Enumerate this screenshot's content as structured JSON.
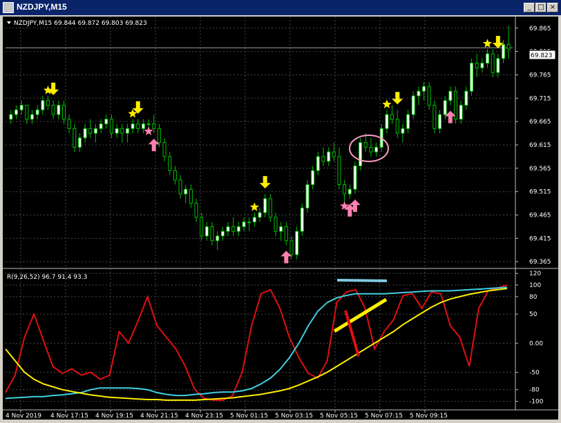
{
  "window": {
    "title": "NZDJPY,M15",
    "buttons": [
      "_",
      "□",
      "×"
    ]
  },
  "header": {
    "symbol_line": "NZDJPY,M15  69.844 69.872 69.803 69.823"
  },
  "price_axis": {
    "labels": [
      "69.865",
      "69.823",
      "69.815",
      "69.765",
      "69.715",
      "69.665",
      "69.615",
      "69.565",
      "69.515",
      "69.465",
      "69.415",
      "69.365"
    ],
    "current_price": "69.823"
  },
  "indicator": {
    "label": "R(9,26,52) 96.7 91.4 93.3",
    "axis_labels": [
      "120",
      "100",
      "80",
      "50",
      "0.00",
      "-50",
      "-80",
      "-100"
    ]
  },
  "time_axis": {
    "labels": [
      "4 Nov 2019",
      "4 Nov 17:15",
      "4 Nov 19:15",
      "4 Nov 21:15",
      "4 Nov 23:15",
      "5 Nov 01:15",
      "5 Nov 03:15",
      "5 Nov 05:15",
      "5 Nov 07:15",
      "5 Nov 09:15"
    ]
  },
  "colors": {
    "background": "#000000",
    "bull_candle": "#ffffff",
    "bear_candle": "#000000",
    "wick": "#00c000",
    "grid": "#4a4a4a",
    "arrow_down": "#ffee00",
    "arrow_up": "#ff7fb0",
    "star_gold": "#ffee00",
    "star_pink": "#ff7fb0",
    "line_red": "#e01010",
    "line_cyan": "#40d0e0",
    "line_yellow": "#ffee00",
    "title_bar": "#0a246a"
  },
  "chart_data": [
    {
      "type": "candlestick",
      "title": "NZDJPY,M15",
      "ohlc": [
        [
          69.67,
          69.69,
          69.66,
          69.68
        ],
        [
          69.68,
          69.7,
          69.67,
          69.69
        ],
        [
          69.69,
          69.71,
          69.68,
          69.7
        ],
        [
          69.7,
          69.7,
          69.66,
          69.67
        ],
        [
          69.67,
          69.69,
          69.66,
          69.68
        ],
        [
          69.68,
          69.7,
          69.67,
          69.69
        ],
        [
          69.69,
          69.72,
          69.68,
          69.71
        ],
        [
          69.71,
          69.72,
          69.69,
          69.7
        ],
        [
          69.7,
          69.71,
          69.67,
          69.68
        ],
        [
          69.68,
          69.71,
          69.67,
          69.7
        ],
        [
          69.7,
          69.71,
          69.66,
          69.67
        ],
        [
          69.67,
          69.68,
          69.64,
          69.65
        ],
        [
          69.65,
          69.66,
          69.6,
          69.61
        ],
        [
          69.61,
          69.64,
          69.6,
          69.63
        ],
        [
          69.63,
          69.66,
          69.62,
          69.65
        ],
        [
          69.65,
          69.67,
          69.63,
          69.64
        ],
        [
          69.64,
          69.66,
          69.62,
          69.65
        ],
        [
          69.65,
          69.67,
          69.64,
          69.66
        ],
        [
          69.66,
          69.68,
          69.65,
          69.67
        ],
        [
          69.67,
          69.68,
          69.63,
          69.64
        ],
        [
          69.64,
          69.66,
          69.63,
          69.65
        ],
        [
          69.65,
          69.66,
          69.62,
          69.64
        ],
        [
          69.64,
          69.66,
          69.62,
          69.65
        ],
        [
          69.65,
          69.67,
          69.64,
          69.66
        ],
        [
          69.66,
          69.67,
          69.64,
          69.65
        ],
        [
          69.65,
          69.67,
          69.64,
          69.66
        ],
        [
          69.66,
          69.67,
          69.65,
          69.66
        ],
        [
          69.66,
          69.68,
          69.64,
          69.65
        ],
        [
          69.65,
          69.66,
          69.61,
          69.62
        ],
        [
          69.62,
          69.63,
          69.58,
          69.59
        ],
        [
          69.59,
          69.6,
          69.55,
          69.56
        ],
        [
          69.56,
          69.57,
          69.53,
          69.54
        ],
        [
          69.54,
          69.55,
          69.5,
          69.51
        ],
        [
          69.51,
          69.53,
          69.49,
          69.52
        ],
        [
          69.52,
          69.53,
          69.48,
          69.49
        ],
        [
          69.49,
          69.5,
          69.45,
          69.46
        ],
        [
          69.46,
          69.47,
          69.41,
          69.42
        ],
        [
          69.42,
          69.45,
          69.41,
          69.44
        ],
        [
          69.44,
          69.45,
          69.4,
          69.41
        ],
        [
          69.41,
          69.43,
          69.39,
          69.42
        ],
        [
          69.42,
          69.44,
          69.41,
          69.43
        ],
        [
          69.43,
          69.45,
          69.42,
          69.44
        ],
        [
          69.44,
          69.46,
          69.42,
          69.43
        ],
        [
          69.43,
          69.45,
          69.42,
          69.44
        ],
        [
          69.44,
          69.46,
          69.43,
          69.45
        ],
        [
          69.45,
          69.46,
          69.43,
          69.45
        ],
        [
          69.45,
          69.47,
          69.44,
          69.46
        ],
        [
          69.46,
          69.48,
          69.45,
          69.47
        ],
        [
          69.47,
          69.51,
          69.46,
          69.5
        ],
        [
          69.5,
          69.51,
          69.45,
          69.46
        ],
        [
          69.46,
          69.47,
          69.42,
          69.43
        ],
        [
          69.43,
          69.45,
          69.41,
          69.44
        ],
        [
          69.44,
          69.45,
          69.4,
          69.41
        ],
        [
          69.41,
          69.42,
          69.37,
          69.38
        ],
        [
          69.38,
          69.44,
          69.37,
          69.43
        ],
        [
          69.43,
          69.49,
          69.42,
          69.48
        ],
        [
          69.48,
          69.54,
          69.47,
          69.53
        ],
        [
          69.53,
          69.57,
          69.52,
          69.56
        ],
        [
          69.56,
          69.6,
          69.55,
          69.59
        ],
        [
          69.59,
          69.61,
          69.57,
          69.58
        ],
        [
          69.58,
          69.61,
          69.57,
          69.6
        ],
        [
          69.6,
          69.62,
          69.58,
          69.59
        ],
        [
          69.59,
          69.61,
          69.52,
          69.53
        ],
        [
          69.53,
          69.54,
          69.49,
          69.51
        ],
        [
          69.51,
          69.53,
          69.5,
          69.52
        ],
        [
          69.52,
          69.58,
          69.51,
          69.57
        ],
        [
          69.57,
          69.63,
          69.56,
          69.62
        ],
        [
          69.62,
          69.64,
          69.6,
          69.61
        ],
        [
          69.61,
          69.63,
          69.59,
          69.6
        ],
        [
          69.6,
          69.62,
          69.59,
          69.61
        ],
        [
          69.61,
          69.66,
          69.6,
          69.65
        ],
        [
          69.65,
          69.69,
          69.64,
          69.68
        ],
        [
          69.68,
          69.7,
          69.66,
          69.67
        ],
        [
          69.67,
          69.69,
          69.63,
          69.64
        ],
        [
          69.64,
          69.66,
          69.62,
          69.65
        ],
        [
          69.65,
          69.69,
          69.64,
          69.68
        ],
        [
          69.68,
          69.73,
          69.67,
          69.72
        ],
        [
          69.72,
          69.74,
          69.7,
          69.73
        ],
        [
          69.73,
          69.75,
          69.71,
          69.74
        ],
        [
          69.74,
          69.75,
          69.69,
          69.7
        ],
        [
          69.7,
          69.71,
          69.64,
          69.65
        ],
        [
          69.65,
          69.69,
          69.64,
          69.68
        ],
        [
          69.68,
          69.72,
          69.67,
          69.71
        ],
        [
          69.71,
          69.74,
          69.7,
          69.73
        ],
        [
          69.73,
          69.74,
          69.66,
          69.67
        ],
        [
          69.67,
          69.71,
          69.66,
          69.7
        ],
        [
          69.7,
          69.74,
          69.69,
          69.73
        ],
        [
          69.73,
          69.8,
          69.72,
          69.79
        ],
        [
          69.79,
          69.81,
          69.76,
          69.78
        ],
        [
          69.78,
          69.8,
          69.77,
          69.79
        ],
        [
          69.79,
          69.82,
          69.78,
          69.81
        ],
        [
          69.81,
          69.82,
          69.76,
          69.77
        ],
        [
          69.77,
          69.81,
          69.76,
          69.8
        ],
        [
          69.8,
          69.84,
          69.79,
          69.83
        ],
        [
          69.83,
          69.87,
          69.8,
          69.82
        ]
      ],
      "ylim": [
        69.355,
        69.875
      ],
      "signals": {
        "arrows_down": [
          8,
          24,
          48,
          73,
          92
        ],
        "arrows_up": [
          27,
          52,
          64,
          65,
          83
        ],
        "stars_gold": [
          7,
          23,
          46,
          71,
          90
        ],
        "stars_pink": [
          26,
          63
        ]
      }
    },
    {
      "type": "line",
      "title": "R(9,26,52) 96.7 91.4 93.3",
      "ylim": [
        -110,
        125
      ],
      "series": [
        {
          "color": "#e01010",
          "values": [
            -85,
            -55,
            10,
            50,
            5,
            -40,
            -52,
            -44,
            -55,
            -50,
            -62,
            -55,
            20,
            0,
            38,
            80,
            30,
            10,
            -10,
            -40,
            -80,
            -95,
            -98,
            -98,
            -90,
            -50,
            30,
            85,
            92,
            60,
            10,
            -25,
            -52,
            -60,
            -30,
            70,
            88,
            92,
            60,
            -10,
            20,
            40,
            82,
            85,
            60,
            88,
            85,
            30,
            10,
            -40,
            60,
            90,
            95,
            100
          ]
        },
        {
          "color": "#40d0e0",
          "values": [
            -95,
            -94,
            -93,
            -92,
            -92,
            -90,
            -89,
            -87,
            -85,
            -80,
            -77,
            -77,
            -77,
            -77,
            -78,
            -80,
            -85,
            -88,
            -90,
            -90,
            -88,
            -87,
            -85,
            -84,
            -84,
            -82,
            -78,
            -70,
            -60,
            -45,
            -25,
            0,
            30,
            55,
            70,
            78,
            82,
            85,
            85,
            85,
            85,
            86,
            87,
            88,
            89,
            90,
            90,
            90,
            91,
            92,
            93,
            94,
            95,
            96
          ]
        },
        {
          "color": "#ffee00",
          "values": [
            -10,
            -30,
            -50,
            -62,
            -70,
            -75,
            -80,
            -83,
            -86,
            -89,
            -91,
            -93,
            -94,
            -95,
            -96,
            -97,
            -97,
            -98,
            -98,
            -98,
            -98,
            -97,
            -96,
            -95,
            -94,
            -92,
            -90,
            -88,
            -85,
            -82,
            -78,
            -72,
            -65,
            -58,
            -50,
            -40,
            -30,
            -20,
            -10,
            0,
            10,
            20,
            32,
            42,
            52,
            62,
            70,
            76,
            80,
            84,
            87,
            90,
            92,
            94
          ]
        }
      ]
    }
  ]
}
